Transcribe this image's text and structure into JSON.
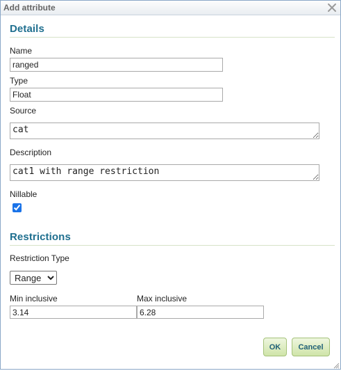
{
  "dialog": {
    "title": "Add attribute",
    "close_icon": "close-icon"
  },
  "details": {
    "heading": "Details",
    "name_label": "Name",
    "name_value": "ranged",
    "type_label": "Type",
    "type_value": "Float",
    "source_label": "Source",
    "source_value": "cat",
    "description_label": "Description",
    "description_value": "cat1 with range restriction",
    "nillable_label": "Nillable",
    "nillable_checked": true
  },
  "restrictions": {
    "heading": "Restrictions",
    "type_label": "Restriction Type",
    "type_selected": "Range",
    "min_label": "Min inclusive",
    "min_value": "3.14",
    "max_label": "Max inclusive",
    "max_value": "6.28"
  },
  "buttons": {
    "ok_label": "OK",
    "cancel_label": "Cancel"
  },
  "colors": {
    "section_heading": "#1f6f8f",
    "button_bg": "#cfe4a8",
    "border": "#8aa7c7"
  }
}
